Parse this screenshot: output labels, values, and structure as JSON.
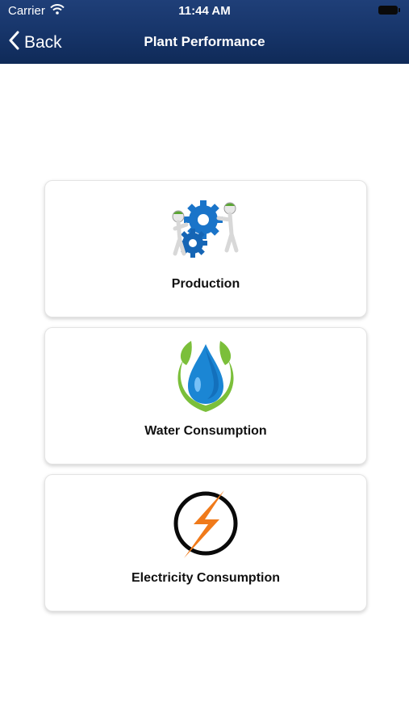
{
  "status_bar": {
    "carrier": "Carrier",
    "time": "11:44 AM"
  },
  "nav": {
    "back_label": "Back",
    "title": "Plant Performance"
  },
  "menu": {
    "items": [
      {
        "label": "Production",
        "icon": "gears-workers-icon"
      },
      {
        "label": "Water Consumption",
        "icon": "water-drop-leaves-icon"
      },
      {
        "label": "Electricity Consumption",
        "icon": "lightning-bolt-icon"
      }
    ]
  },
  "colors": {
    "nav_background": "#17356a",
    "gear_blue": "#1a74c9",
    "leaf_green": "#7bbf3a",
    "bolt_orange": "#f07a1a"
  }
}
